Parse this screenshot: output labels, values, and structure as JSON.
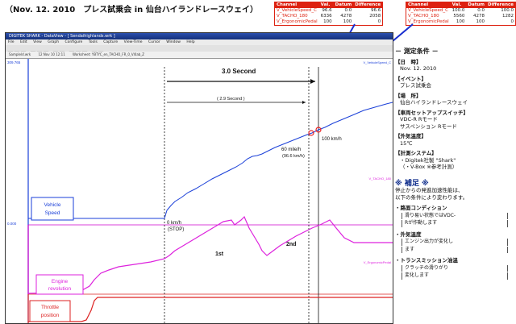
{
  "header": {
    "title": "（Nov. 12. 2010　プレス試乗会 in 仙台ハイランドレースウェイ）"
  },
  "table_left": {
    "columns": [
      "Channel",
      "Val.",
      "Datum",
      "Difference"
    ],
    "rows": [
      [
        "V_VehicleSpeed_C",
        "96.6",
        "0.0",
        "96.6"
      ],
      [
        "V_TACHO_180",
        "6336",
        "4278",
        "2058"
      ],
      [
        "V_ErgonomicPedal",
        "100",
        "100",
        "0"
      ]
    ]
  },
  "table_right": {
    "columns": [
      "Channel",
      "Val.",
      "Datum",
      "Difference"
    ],
    "rows": [
      [
        "V_VehicleSpeed_C",
        "100.0",
        "0.0",
        "100.0"
      ],
      [
        "V_TACHO_180",
        "5560",
        "4278",
        "1282"
      ],
      [
        "V_ErgonomicPedal",
        "100",
        "100",
        "0"
      ]
    ]
  },
  "window": {
    "title": "DIGITEK SHARK - DataView - [ Sendaihighlands.wrk ]",
    "menu": [
      "File",
      "Edit",
      "View",
      "Graph",
      "Configure",
      "Tools",
      "Capture",
      "View-Time",
      "Cursor",
      "Window",
      "Help"
    ],
    "tabs": [
      "Sampleld.wrk",
      "12 Nov 10 12:11",
      "Worksheet: YBTYC_en_TACHO_FR_0_V4lab_Z"
    ]
  },
  "plot": {
    "ymax_label": "309.765",
    "ymin_label": "0.000",
    "interval_label": "3.0 Second",
    "interval_sub": "( 2.9 Second )",
    "annot_100": "100 km/h",
    "annot_60a": "60 mile/h",
    "annot_60b": "(96.6 km/h)",
    "annot_0a": "0 km/h",
    "annot_0b": "(STOP)",
    "gear1": "1st",
    "gear2": "2nd",
    "label_speed1": "Vehicle",
    "label_speed2": "Speed",
    "label_rev1": "Engine",
    "label_rev2": "revolution",
    "label_thr1": "Throttle",
    "label_thr2": "position",
    "ch_speed": "V_VehicleSpeed_C",
    "ch_tacho": "V_TACHO_180",
    "ch_pedal": "V_ErgonomicPedal"
  },
  "conditions": {
    "heading": "－ 測定条件 －",
    "items": [
      {
        "label": "【日　時】",
        "value": "Nov. 12. 2010"
      },
      {
        "label": "【イベント】",
        "value": "プレス試乗会"
      },
      {
        "label": "【場　所】",
        "value": "仙台ハイランドレースウェイ"
      },
      {
        "label": "【車両セットアップスイッチ】",
        "value": "VDC-R Rモード"
      },
      {
        "label": "",
        "value": "サスペンション Rモード"
      },
      {
        "label": "【外気温度】",
        "value": "15℃"
      },
      {
        "label": "【計測システム】",
        "value": "・Digitek社製 \"Shark\""
      },
      {
        "label": "",
        "value": "（・V-Box ※参考計測）"
      }
    ]
  },
  "notes": {
    "heading": "※ 補足 ※",
    "intro1": "停止からの発進加速性能は、",
    "intro2": "以下の条件により変わります。",
    "b1": "・路面コンディション",
    "b1d1": "滑り易い状態ではVDC-",
    "b1d2": "Rが作動します",
    "b2": "・外気温度",
    "b2d1": "エンジン出力が変化し",
    "b2d2": "ます",
    "b3": "・トランスミッション油温",
    "b3d1": "クラッチの滑りがり",
    "b3d2": "変化します"
  }
}
